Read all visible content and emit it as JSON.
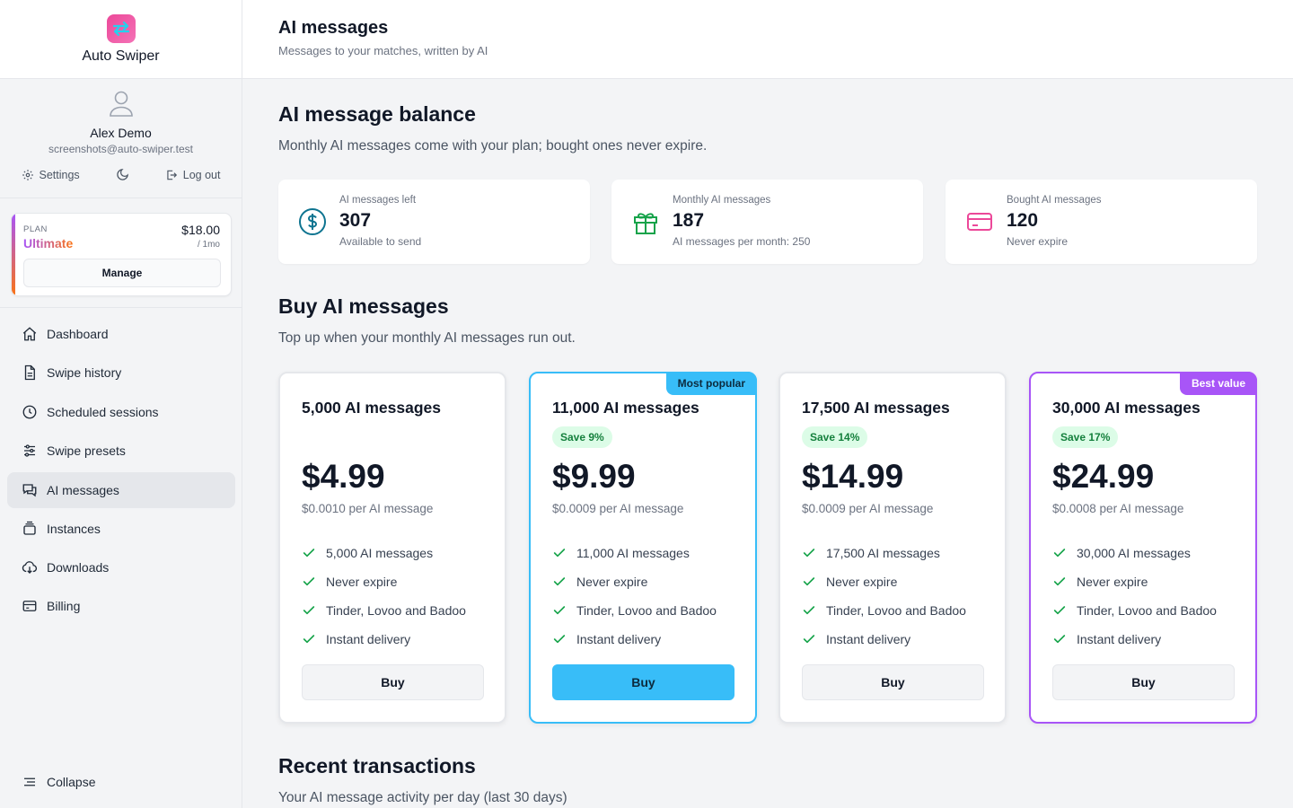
{
  "app": {
    "name": "Auto Swiper"
  },
  "user": {
    "name": "Alex Demo",
    "email": "screenshots@auto-swiper.test",
    "settings_label": "Settings",
    "logout_label": "Log out"
  },
  "plan": {
    "label": "PLAN",
    "name": "Ultimate",
    "price": "$18.00",
    "period": "/ 1mo",
    "manage_label": "Manage"
  },
  "nav": {
    "items": [
      {
        "label": "Dashboard",
        "icon": "home-icon"
      },
      {
        "label": "Swipe history",
        "icon": "document-icon"
      },
      {
        "label": "Scheduled sessions",
        "icon": "clock-icon"
      },
      {
        "label": "Swipe presets",
        "icon": "sliders-icon"
      },
      {
        "label": "AI messages",
        "icon": "chat-icon",
        "active": true
      },
      {
        "label": "Instances",
        "icon": "stack-icon"
      },
      {
        "label": "Downloads",
        "icon": "cloud-download-icon"
      },
      {
        "label": "Billing",
        "icon": "credit-card-icon"
      }
    ],
    "collapse_label": "Collapse"
  },
  "header": {
    "title": "AI messages",
    "subtitle": "Messages to your matches, written by AI"
  },
  "balance": {
    "title": "AI message balance",
    "subtitle": "Monthly AI messages come with your plan; bought ones never expire.",
    "stats": [
      {
        "label": "AI messages left",
        "value": "307",
        "note": "Available to send",
        "icon": "dollar-circle-icon",
        "color": "#0e7490"
      },
      {
        "label": "Monthly AI messages",
        "value": "187",
        "note": "AI messages per month: 250",
        "icon": "gift-icon",
        "color": "#16a34a"
      },
      {
        "label": "Bought AI messages",
        "value": "120",
        "note": "Never expire",
        "icon": "credit-card-icon",
        "color": "#ec4899"
      }
    ]
  },
  "buy": {
    "title": "Buy AI messages",
    "subtitle": "Top up when your monthly AI messages run out.",
    "packages": [
      {
        "title": "5,000 AI messages",
        "save": "",
        "price": "$4.99",
        "per": "$0.0010 per AI message",
        "ribbon": "",
        "features": [
          "5,000 AI messages",
          "Never expire",
          "Tinder, Lovoo and Badoo",
          "Instant delivery"
        ],
        "buy_label": "Buy"
      },
      {
        "title": "11,000 AI messages",
        "save": "Save 9%",
        "price": "$9.99",
        "per": "$0.0009 per AI message",
        "ribbon": "Most popular",
        "features": [
          "11,000 AI messages",
          "Never expire",
          "Tinder, Lovoo and Badoo",
          "Instant delivery"
        ],
        "buy_label": "Buy"
      },
      {
        "title": "17,500 AI messages",
        "save": "Save 14%",
        "price": "$14.99",
        "per": "$0.0009 per AI message",
        "ribbon": "",
        "features": [
          "17,500 AI messages",
          "Never expire",
          "Tinder, Lovoo and Badoo",
          "Instant delivery"
        ],
        "buy_label": "Buy"
      },
      {
        "title": "30,000 AI messages",
        "save": "Save 17%",
        "price": "$24.99",
        "per": "$0.0008 per AI message",
        "ribbon": "Best value",
        "features": [
          "30,000 AI messages",
          "Never expire",
          "Tinder, Lovoo and Badoo",
          "Instant delivery"
        ],
        "buy_label": "Buy"
      }
    ]
  },
  "transactions": {
    "title": "Recent transactions",
    "subtitle": "Your AI message activity per day (last 30 days)"
  },
  "colors": {
    "accent": "#38bdf8",
    "best": "#a855f7",
    "success": "#16a34a"
  }
}
